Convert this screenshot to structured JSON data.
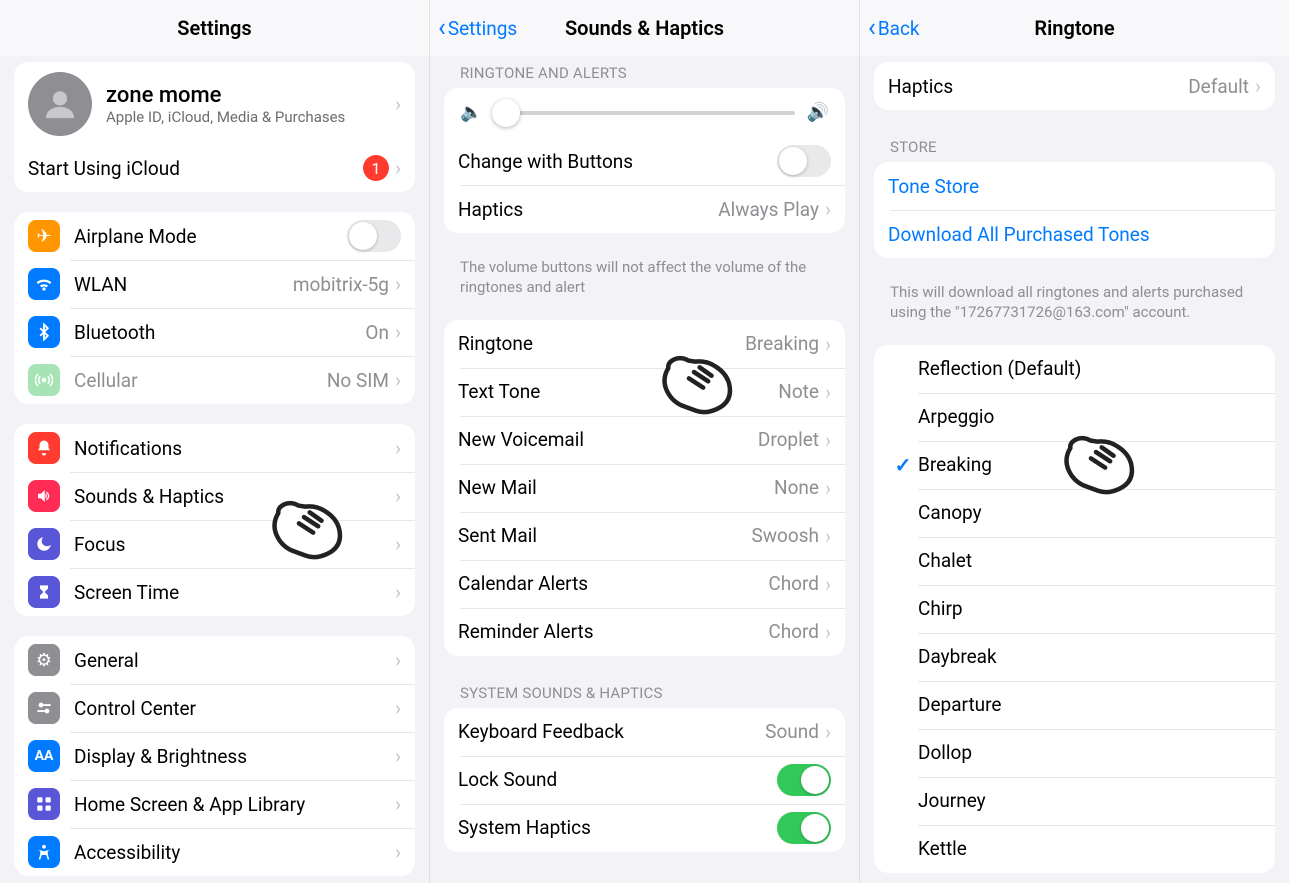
{
  "pane1": {
    "title": "Settings",
    "account": {
      "name": "zone mome",
      "sub": "Apple ID, iCloud, Media & Purchases"
    },
    "icloud_row": {
      "label": "Start Using iCloud",
      "badge": "1"
    },
    "net": {
      "airplane": "Airplane Mode",
      "wlan": "WLAN",
      "wlan_val": "mobitrix-5g",
      "bt": "Bluetooth",
      "bt_val": "On",
      "cell": "Cellular",
      "cell_val": "No SIM"
    },
    "attn": {
      "notif": "Notifications",
      "sounds": "Sounds & Haptics",
      "focus": "Focus",
      "screen": "Screen Time"
    },
    "sys": {
      "general": "General",
      "control": "Control Center",
      "display": "Display & Brightness",
      "home": "Home Screen & App Library",
      "acc": "Accessibility"
    }
  },
  "pane2": {
    "back": "Settings",
    "title": "Sounds & Haptics",
    "sect1": "RINGTONE AND ALERTS",
    "change_btn": "Change with Buttons",
    "haptics": "Haptics",
    "haptics_val": "Always Play",
    "footer1": "The volume buttons will not affect the volume of the ringtones and alert",
    "tones": {
      "ringtone": "Ringtone",
      "ringtone_val": "Breaking",
      "text": "Text Tone",
      "text_val": "Note",
      "vm": "New Voicemail",
      "vm_val": "Droplet",
      "mail": "New Mail",
      "mail_val": "None",
      "sent": "Sent Mail",
      "sent_val": "Swoosh",
      "cal": "Calendar Alerts",
      "cal_val": "Chord",
      "rem": "Reminder Alerts",
      "rem_val": "Chord"
    },
    "sect2": "SYSTEM SOUNDS & HAPTICS",
    "kb": "Keyboard Feedback",
    "kb_val": "Sound",
    "lock": "Lock Sound",
    "syshap": "System Haptics"
  },
  "pane3": {
    "back": "Back",
    "title": "Ringtone",
    "haptics": "Haptics",
    "haptics_val": "Default",
    "store_label": "STORE",
    "tone_store": "Tone Store",
    "download": "Download All Purchased Tones",
    "store_footer": "This will download all ringtones and alerts purchased using the \"17267731726@163.com\" account.",
    "default_tone": "Reflection (Default)",
    "tones": [
      "Arpeggio",
      "Breaking",
      "Canopy",
      "Chalet",
      "Chirp",
      "Daybreak",
      "Departure",
      "Dollop",
      "Journey",
      "Kettle"
    ],
    "selected": "Breaking"
  }
}
